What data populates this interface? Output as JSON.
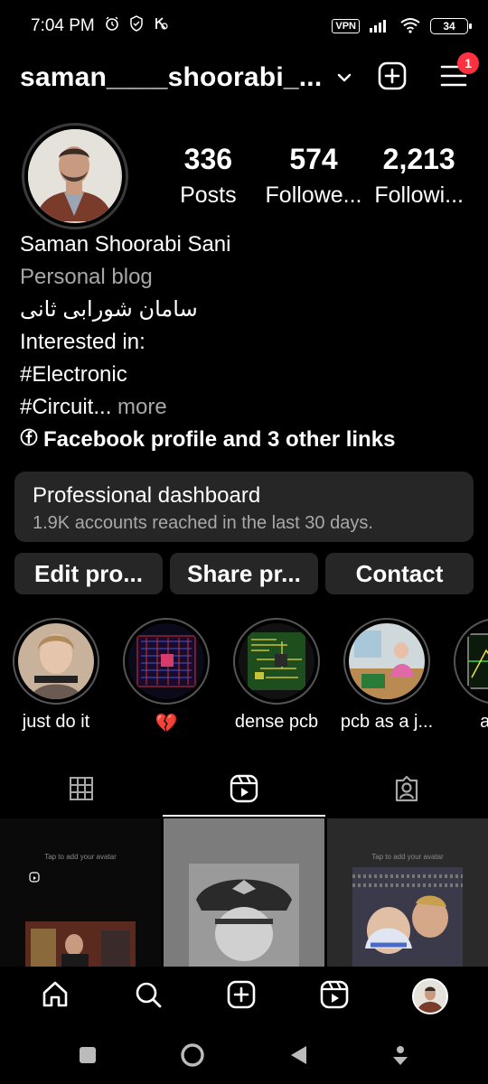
{
  "status_bar": {
    "time": "7:04 PM",
    "vpn": "VPN",
    "battery": "34"
  },
  "header": {
    "username": "saman____shoorabi_...",
    "notification_count": "1"
  },
  "profile": {
    "stats": [
      {
        "value": "336",
        "label": "Posts"
      },
      {
        "value": "574",
        "label": "Followe..."
      },
      {
        "value": "2,213",
        "label": "Followi..."
      }
    ],
    "name": "Saman Shoorabi Sani",
    "category": "Personal blog",
    "persian_name": "سامان شورابی ثانی",
    "bio_line1": "Interested in:",
    "bio_line2": "#Electronic",
    "bio_line3": "#Circuit...",
    "more": " more",
    "links": "Facebook profile and 3 other links"
  },
  "dashboard": {
    "title": "Professional dashboard",
    "subtitle": "1.9K accounts reached in the last 30 days."
  },
  "actions": {
    "edit": "Edit pro...",
    "share": "Share pr...",
    "contact": "Contact"
  },
  "highlights": [
    {
      "label": "just do it"
    },
    {
      "label": "💔"
    },
    {
      "label": "dense pcb"
    },
    {
      "label": "pcb as a j..."
    },
    {
      "label": "anal"
    }
  ],
  "grid": {
    "hint": "Tap to add your avatar"
  },
  "colors": {
    "background": "#000000",
    "card": "#262626",
    "muted_text": "#a8a8a8",
    "badge": "#ff3040"
  }
}
